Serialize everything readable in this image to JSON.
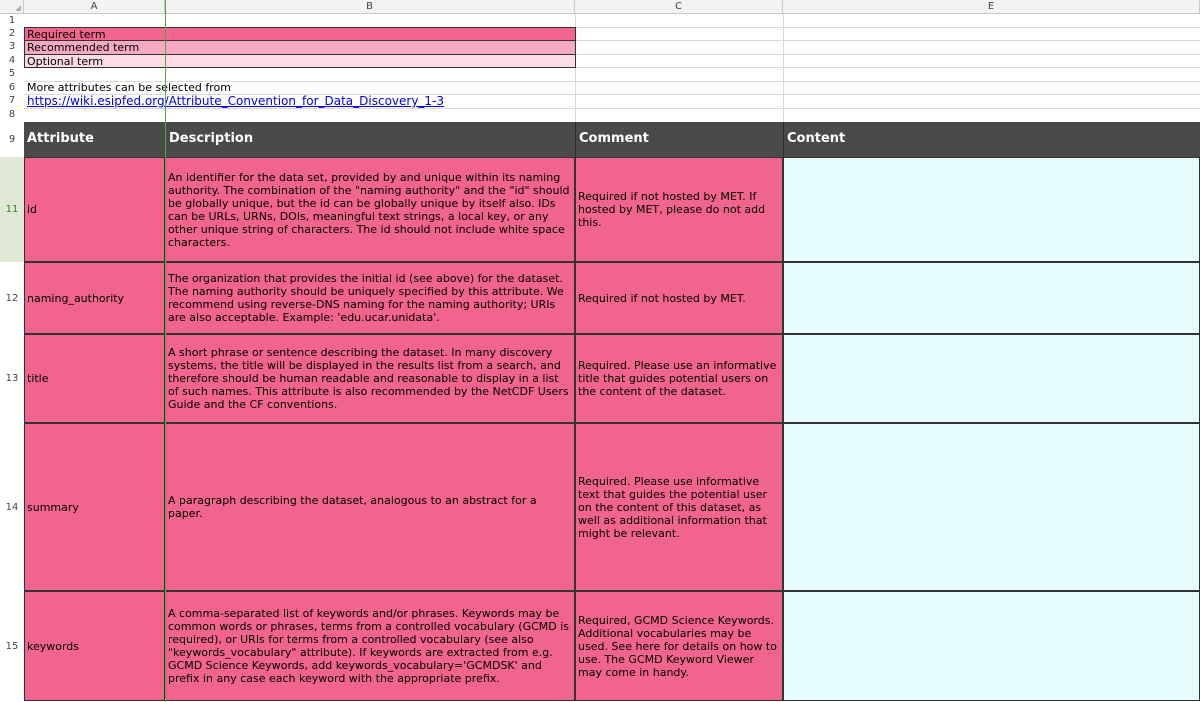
{
  "columns": [
    "A",
    "B",
    "C",
    "E"
  ],
  "row_numbers": [
    "1",
    "2",
    "3",
    "4",
    "5",
    "6",
    "7",
    "8",
    "9",
    "11",
    "12",
    "13",
    "14",
    "15"
  ],
  "legend": {
    "required": "Required term",
    "recommended": "Recommended term",
    "optional": "Optional term"
  },
  "info": {
    "text": "More attributes can be selected from",
    "link": "https://wiki.esipfed.org/Attribute_Convention_for_Data_Discovery_1-3"
  },
  "header": {
    "attribute": "Attribute",
    "description": "Description",
    "comment": "Comment",
    "content": "Content"
  },
  "rows": [
    {
      "attribute": "id",
      "description": "An identifier for the data set, provided by and unique within its naming authority. The combination of the \"naming authority\" and the \"id\" should be globally unique, but the id can be globally unique by itself also. IDs can be URLs, URNs, DOIs, meaningful text strings, a local key, or any other unique string of characters. The id should not include white space characters.",
      "comment": "Required if not hosted by MET. If hosted by MET, please do not add this."
    },
    {
      "attribute": "naming_authority",
      "description": "The organization that provides the initial id (see above) for the dataset. The naming authority should be uniquely specified by this attribute. We recommend using reverse-DNS naming for the naming authority; URIs are also acceptable. Example: 'edu.ucar.unidata'.",
      "comment": "Required if not hosted by MET."
    },
    {
      "attribute": "title",
      "description": "A short phrase or sentence describing the dataset. In many discovery systems, the title will be displayed in the results list from a search, and therefore should be human readable and reasonable to display in a list of such names. This attribute is also recommended by the NetCDF Users Guide and the CF conventions.",
      "comment": "Required. Please use an informative title that guides potential users on the content of the dataset."
    },
    {
      "attribute": "summary",
      "description": "A paragraph describing the dataset, analogous to an abstract for a paper.",
      "comment": "Required. Please use informative text that guides the potential user on the content of this dataset, as well as additional information that might be relevant."
    },
    {
      "attribute": "keywords",
      "description": "A comma-separated list of keywords and/or phrases. Keywords may be common words or phrases, terms from a controlled vocabulary (GCMD is required), or URIs for terms from a controlled vocabulary (see also \"keywords_vocabulary\" attribute). If keywords are extracted from e.g. GCMD Science Keywords, add keywords_vocabulary='GCMDSK' and prefix in any case each keyword with the appropriate prefix.",
      "comment": "Required, GCMD Science Keywords. Additional vocabularies may be used. See here for details on how to use. The GCMD Keyword Viewer may come in handy."
    }
  ]
}
